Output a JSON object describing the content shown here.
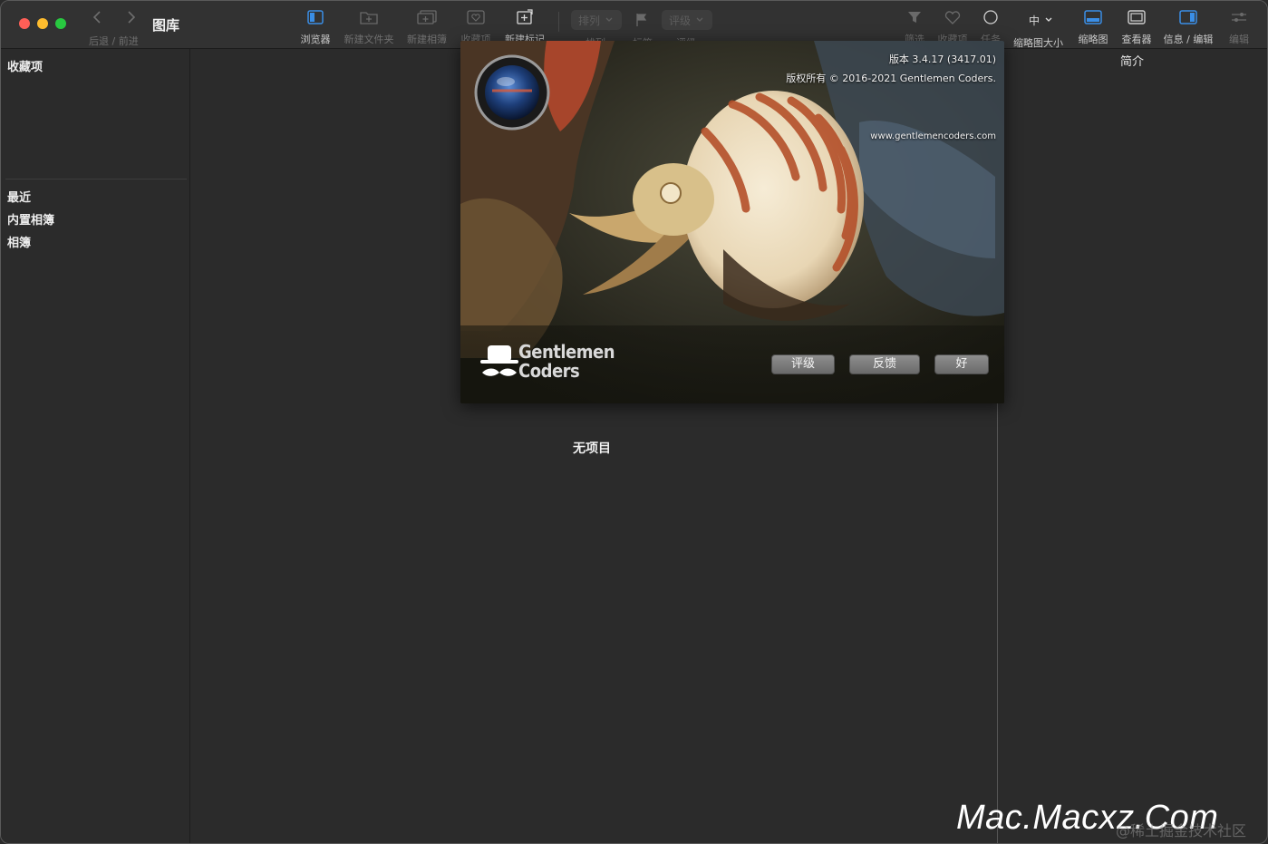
{
  "window": {
    "title": "图库",
    "nav_label": "后退 / 前进"
  },
  "toolbar": {
    "browser": "浏览器",
    "new_folder": "新建文件夹",
    "new_album": "新建相簿",
    "favorites_partial": "收藏项",
    "new_tag": "新建标记",
    "sort_popup": "排列",
    "sort_label": "排列",
    "flag_label": "标签",
    "rating_popup": "评级",
    "rating_label": "评级",
    "filter_label": "筛选",
    "favorites_label": "收藏项",
    "tasks_label": "任务",
    "thumb_size_value": "中",
    "thumb_size_label": "缩略图大小",
    "thumbnail_label": "缩略图",
    "viewer_label": "查看器",
    "info_edit_label": "信息 / 编辑",
    "edit_label": "编辑"
  },
  "sidebar": {
    "favorites_header": "收藏项",
    "items": [
      {
        "label": "最近"
      },
      {
        "label": "内置相簿"
      },
      {
        "label": "相簿"
      }
    ]
  },
  "main": {
    "empty_text": "无项目"
  },
  "right_panel": {
    "title": "简介"
  },
  "about": {
    "version": "版本 3.4.17 (3417.01)",
    "copyright": "版权所有 © 2016-2021 Gentlemen Coders.",
    "website": "www.gentlemencoders.com",
    "logo_line1": "Gentlemen",
    "logo_line2": "Coders",
    "buttons": {
      "rate": "评级",
      "feedback": "反馈",
      "ok": "好"
    }
  },
  "watermark": {
    "text": "Mac.Macxz.Com",
    "sub": "@稀土掘金技术社区"
  },
  "colors": {
    "accent_blue": "#3a8ee6",
    "window_bg": "#2b2b2b"
  }
}
